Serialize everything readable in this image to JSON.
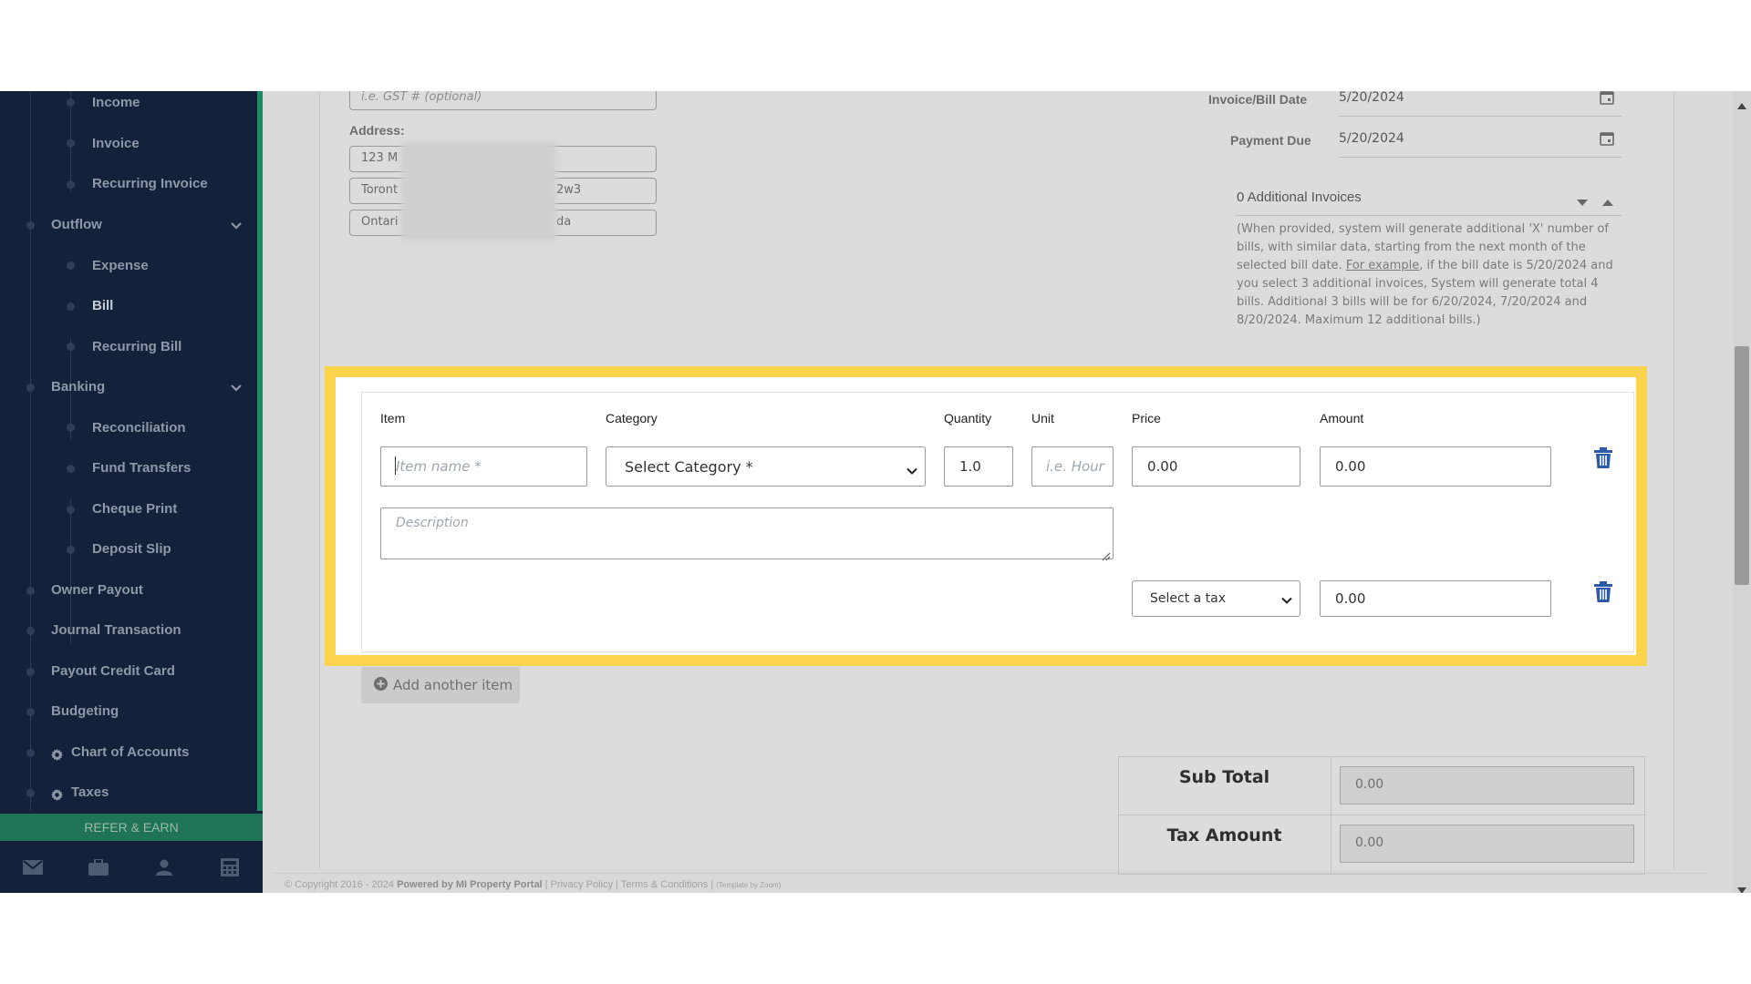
{
  "sidebar": {
    "items": [
      {
        "label": "Income",
        "level": "sub"
      },
      {
        "label": "Invoice",
        "level": "sub"
      },
      {
        "label": "Recurring Invoice",
        "level": "sub"
      },
      {
        "label": "Outflow",
        "level": "group",
        "expanded": true
      },
      {
        "label": "Expense",
        "level": "sub"
      },
      {
        "label": "Bill",
        "level": "sub",
        "active": true
      },
      {
        "label": "Recurring Bill",
        "level": "sub"
      },
      {
        "label": "Banking",
        "level": "group",
        "expanded": true
      },
      {
        "label": "Reconciliation",
        "level": "sub"
      },
      {
        "label": "Fund Transfers",
        "level": "sub"
      },
      {
        "label": "Cheque Print",
        "level": "sub"
      },
      {
        "label": "Deposit Slip",
        "level": "sub"
      },
      {
        "label": "Owner Payout",
        "level": "top"
      },
      {
        "label": "Journal Transaction",
        "level": "top"
      },
      {
        "label": "Payout Credit Card",
        "level": "top"
      },
      {
        "label": "Budgeting",
        "level": "top"
      },
      {
        "label": "Chart of Accounts",
        "level": "top",
        "icon": "gear-icon"
      },
      {
        "label": "Taxes",
        "level": "top",
        "icon": "gear-icon"
      }
    ],
    "refer_label": "REFER & EARN",
    "bottom_icons": [
      "mail-icon",
      "briefcase-icon",
      "user-icon",
      "calculator-icon"
    ]
  },
  "vendor": {
    "tax_placeholder": "i.e. GST # (optional)",
    "address_label": "Address:",
    "address_lines": [
      "123 M",
      "Toront",
      "Ontari"
    ],
    "address_suffixes": [
      "",
      "2w3",
      "da"
    ]
  },
  "dates": {
    "invoice_label": "Invoice/Bill Date",
    "invoice_value": "5/20/2024",
    "due_label": "Payment Due",
    "due_value": "5/20/2024"
  },
  "additional": {
    "label": "0 Additional Invoices",
    "note_before": "(When provided, system will generate additional 'X' number of bills, with similar data, starting from the next month of the selected bill date. ",
    "note_link": "For example",
    "note_after": ", if the bill date is 5/20/2024 and you select 3 additional invoices, System will generate total 4 bills. Additional 3 bills will be for 6/20/2024, 7/20/2024 and 8/20/2024. Maximum 12 additional bills.)"
  },
  "item_form": {
    "headers": {
      "item": "Item",
      "category": "Category",
      "quantity": "Quantity",
      "unit": "Unit",
      "price": "Price",
      "amount": "Amount"
    },
    "item_placeholder": "Item name *",
    "category_selected": "Select Category *",
    "quantity_value": "1.0",
    "unit_placeholder": "i.e. Hour",
    "price_value": "0.00",
    "amount_value": "0.00",
    "description_placeholder": "Description",
    "tax_selected": "Select a tax",
    "tax_amount_value": "0.00"
  },
  "add_item_label": "Add another item",
  "totals": {
    "subtotal_label": "Sub Total",
    "subtotal_value": "0.00",
    "tax_label": "Tax Amount",
    "tax_value": "0.00"
  },
  "footer": {
    "copyright": "© Copyright 2016 - 2024",
    "powered": "Powered by MI Property Portal",
    "privacy": "Privacy Policy",
    "terms": "Terms & Conditions",
    "credit": "(Template by Zoom)"
  },
  "colors": {
    "sidebar_bg": "#13213a",
    "accent_green": "#1f8a66",
    "highlight": "#fcd34d",
    "trash_blue": "#2d5aa8"
  }
}
